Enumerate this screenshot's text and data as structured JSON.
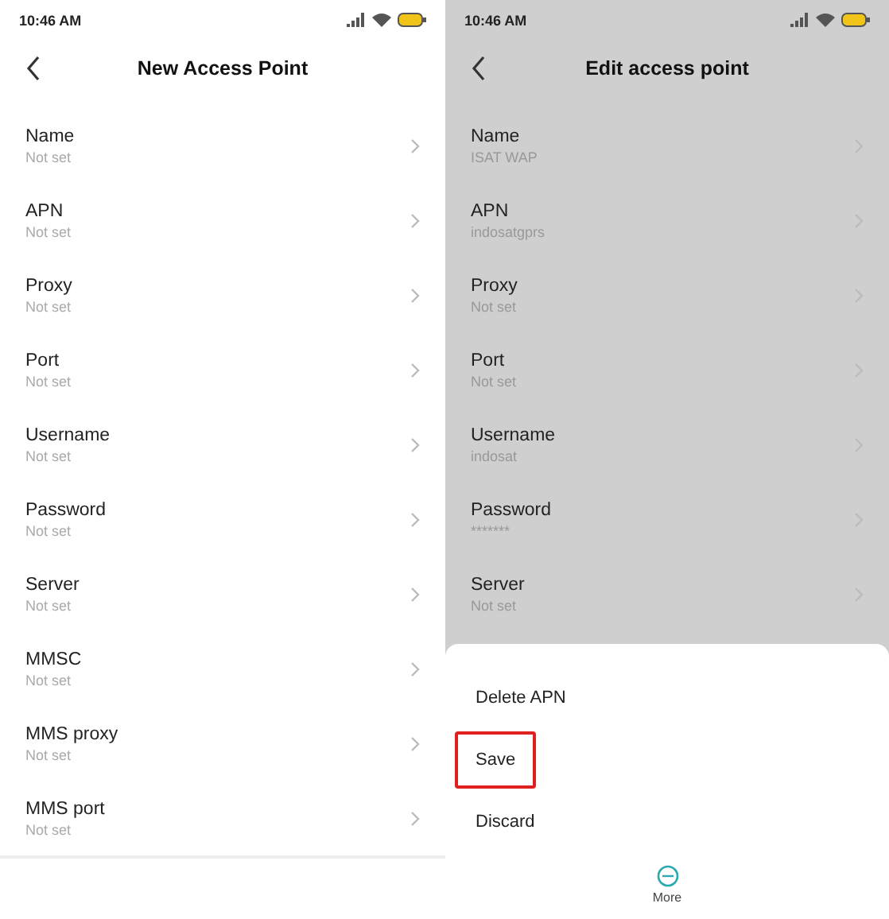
{
  "screens": [
    {
      "time": "10:46 AM",
      "title": "New Access Point",
      "dimmed": false,
      "fields": [
        {
          "label": "Name",
          "value": "Not set"
        },
        {
          "label": "APN",
          "value": "Not set"
        },
        {
          "label": "Proxy",
          "value": "Not set"
        },
        {
          "label": "Port",
          "value": "Not set"
        },
        {
          "label": "Username",
          "value": "Not set"
        },
        {
          "label": "Password",
          "value": "Not set"
        },
        {
          "label": "Server",
          "value": "Not set"
        },
        {
          "label": "MMSC",
          "value": "Not set"
        },
        {
          "label": "MMS proxy",
          "value": "Not set"
        },
        {
          "label": "MMS port",
          "value": "Not set"
        }
      ]
    },
    {
      "time": "10:46 AM",
      "title": "Edit access point",
      "dimmed": true,
      "fields": [
        {
          "label": "Name",
          "value": "ISAT WAP"
        },
        {
          "label": "APN",
          "value": "indosatgprs"
        },
        {
          "label": "Proxy",
          "value": "Not set"
        },
        {
          "label": "Port",
          "value": "Not set"
        },
        {
          "label": "Username",
          "value": "indosat"
        },
        {
          "label": "Password",
          "value": "*******"
        },
        {
          "label": "Server",
          "value": "Not set"
        }
      ],
      "menu": {
        "items": [
          {
            "label": "Delete APN",
            "highlighted": false
          },
          {
            "label": "Save",
            "highlighted": true
          },
          {
            "label": "Discard",
            "highlighted": false
          }
        ],
        "more": "More"
      }
    }
  ]
}
